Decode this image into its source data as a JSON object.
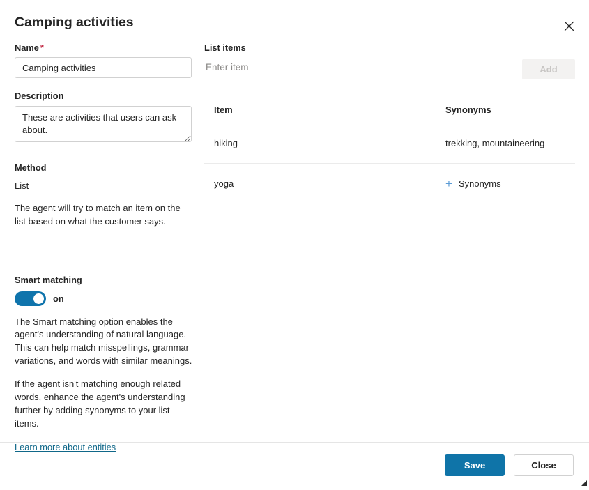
{
  "dialog": {
    "title": "Camping activities",
    "close_icon": "close-icon"
  },
  "form": {
    "name": {
      "label": "Name",
      "required_marker": "*",
      "value": "Camping activities",
      "placeholder": ""
    },
    "description": {
      "label": "Description",
      "value": "These are activities that users can ask about.",
      "placeholder": ""
    },
    "method": {
      "label": "Method",
      "value": "List",
      "help": "The agent will try to match an item on the list based on what the customer says."
    },
    "smart_matching": {
      "label": "Smart matching",
      "state": "on",
      "enabled": true,
      "paragraph_1": "The Smart matching option enables the agent's understanding of natural language. This can help match misspellings, grammar variations, and words with similar meanings.",
      "paragraph_2": "If the agent isn't matching enough related words, enhance the agent's understanding further by adding synonyms to your list items."
    },
    "learn_more_link": "Learn more about entities"
  },
  "list_items": {
    "label": "List items",
    "input_value": "",
    "input_placeholder": "Enter item",
    "add_button": "Add",
    "add_button_disabled": true,
    "columns": [
      "Item",
      "Synonyms"
    ],
    "rows": [
      {
        "item": "hiking",
        "synonyms": "trekking, mountaineering",
        "has_synonyms": true,
        "add_label": ""
      },
      {
        "item": "yoga",
        "synonyms": "",
        "has_synonyms": false,
        "add_label": "Synonyms"
      }
    ]
  },
  "footer": {
    "save_label": "Save",
    "close_label": "Close"
  },
  "colors": {
    "primary": "#0f74a8",
    "toggle_on": "#0f74ac",
    "link": "#0f6789",
    "required": "#c4314b",
    "plus": "#5b9bd5"
  }
}
